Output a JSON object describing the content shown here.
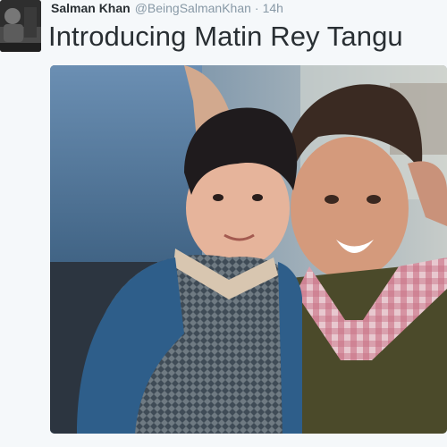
{
  "tweet": {
    "author": {
      "name": "Salman Khan",
      "handle": "@BeingSalmanKhan",
      "avatar_icon": "avatar-photo"
    },
    "separator": "·",
    "time": "14h",
    "text": "Introducing Matin Rey Tangu",
    "media": {
      "type": "photo"
    }
  },
  "colors": {
    "background": "#f5f8fa",
    "name_text": "#292f33",
    "secondary_text": "#8899a6"
  }
}
